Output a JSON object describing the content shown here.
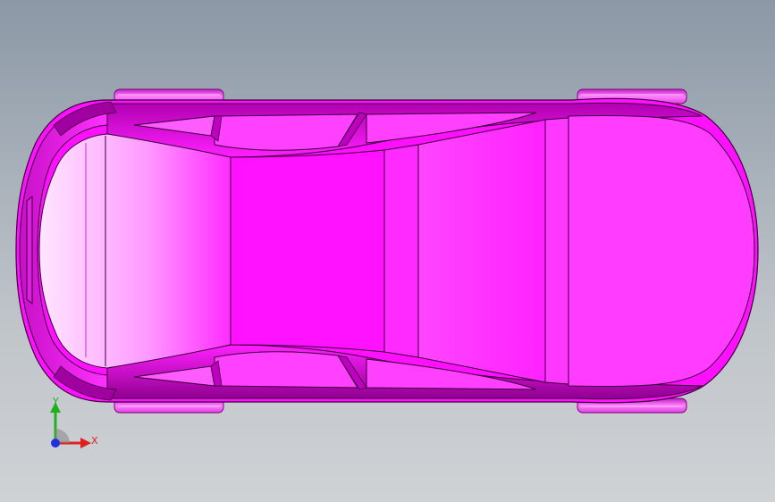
{
  "viewport": {
    "background_top": "#8b98a6",
    "background_bottom": "#cfd2d5"
  },
  "model": {
    "body_color": "#ff10ff",
    "edge_color": "#3a003a",
    "highlight_color": "#ffd8ff",
    "shadow_color": "#b000b0",
    "wheel_color": "#e030e0"
  },
  "triad": {
    "x_label": "X",
    "y_label": "Y",
    "x_color": "#e02020",
    "y_color": "#20b020",
    "z_color": "#2030e0",
    "icon": "coordinate-triad-icon"
  }
}
